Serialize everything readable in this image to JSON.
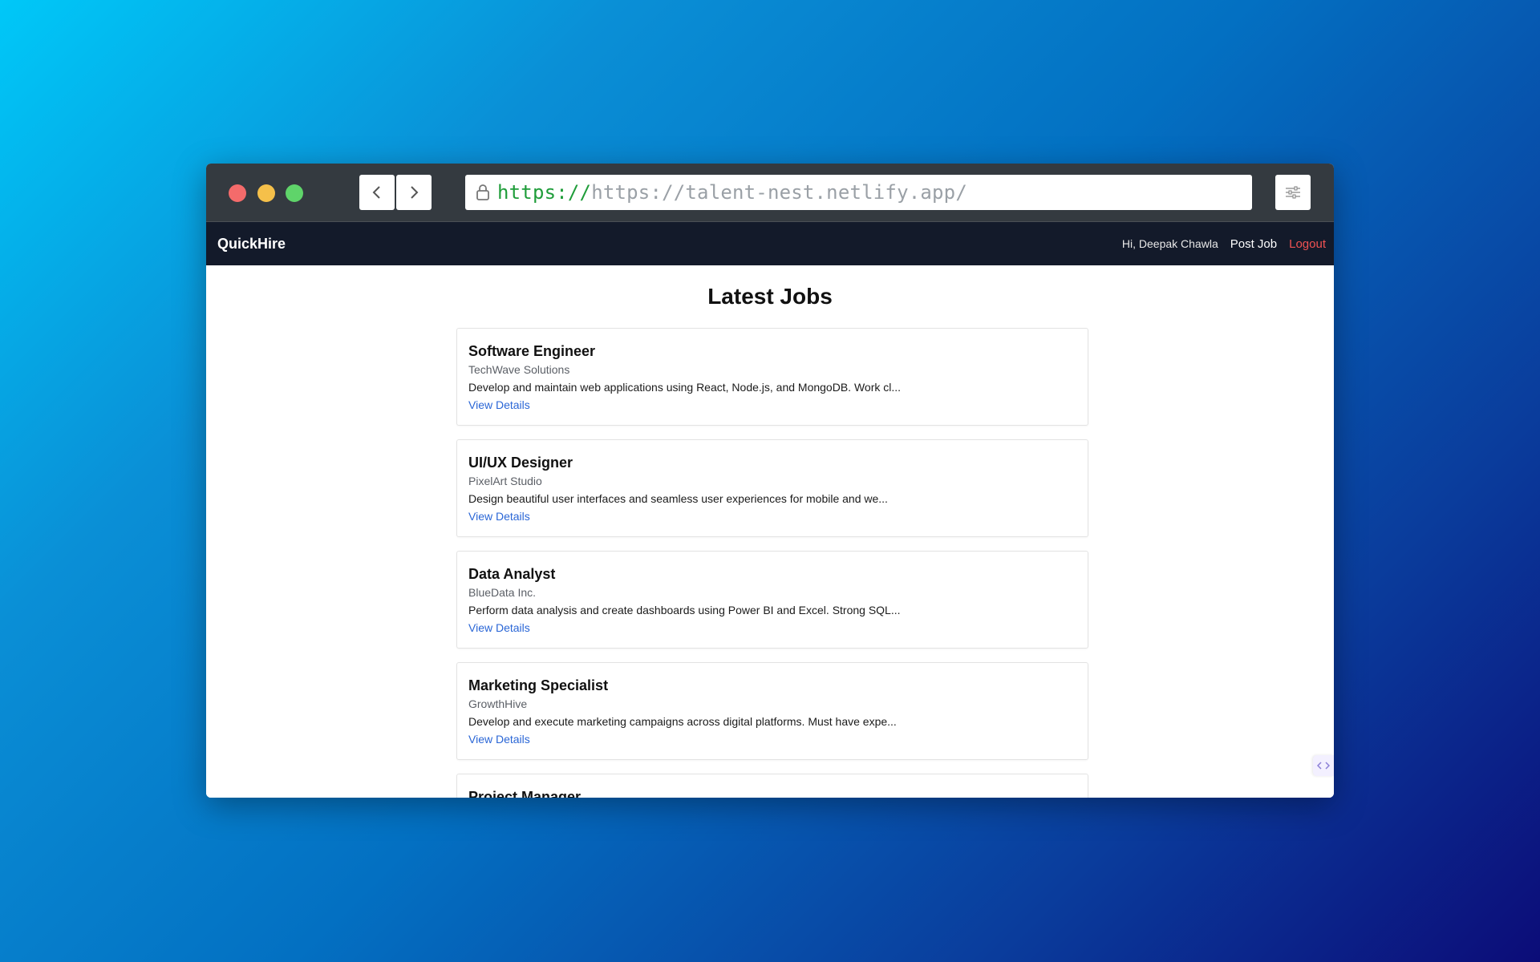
{
  "browser": {
    "url_scheme": "https://",
    "url_rest": "https://talent-nest.netlify.app/",
    "icons": {
      "back": "chevron-left-icon",
      "forward": "chevron-right-icon",
      "lock": "lock-icon",
      "settings": "sliders-icon"
    }
  },
  "navbar": {
    "brand": "QuickHire",
    "greeting": "Hi, Deepak Chawla",
    "post_job": "Post Job",
    "logout": "Logout"
  },
  "main": {
    "title": "Latest Jobs",
    "jobs": [
      {
        "title": "Software Engineer",
        "company": "TechWave Solutions",
        "description": "Develop and maintain web applications using React, Node.js, and MongoDB. Work cl...",
        "link": "View Details"
      },
      {
        "title": "UI/UX Designer",
        "company": "PixelArt Studio",
        "description": "Design beautiful user interfaces and seamless user experiences for mobile and we...",
        "link": "View Details"
      },
      {
        "title": "Data Analyst",
        "company": "BlueData Inc.",
        "description": "Perform data analysis and create dashboards using Power BI and Excel. Strong SQL...",
        "link": "View Details"
      },
      {
        "title": "Marketing Specialist",
        "company": "GrowthHive",
        "description": "Develop and execute marketing campaigns across digital platforms. Must have expe...",
        "link": "View Details"
      },
      {
        "title": "Project Manager",
        "company": "",
        "description": "",
        "link": ""
      }
    ]
  },
  "colors": {
    "navbar_bg": "#131a2a",
    "logout": "#f05252",
    "link": "#2a66d6",
    "url_scheme": "#1f9d3a"
  }
}
